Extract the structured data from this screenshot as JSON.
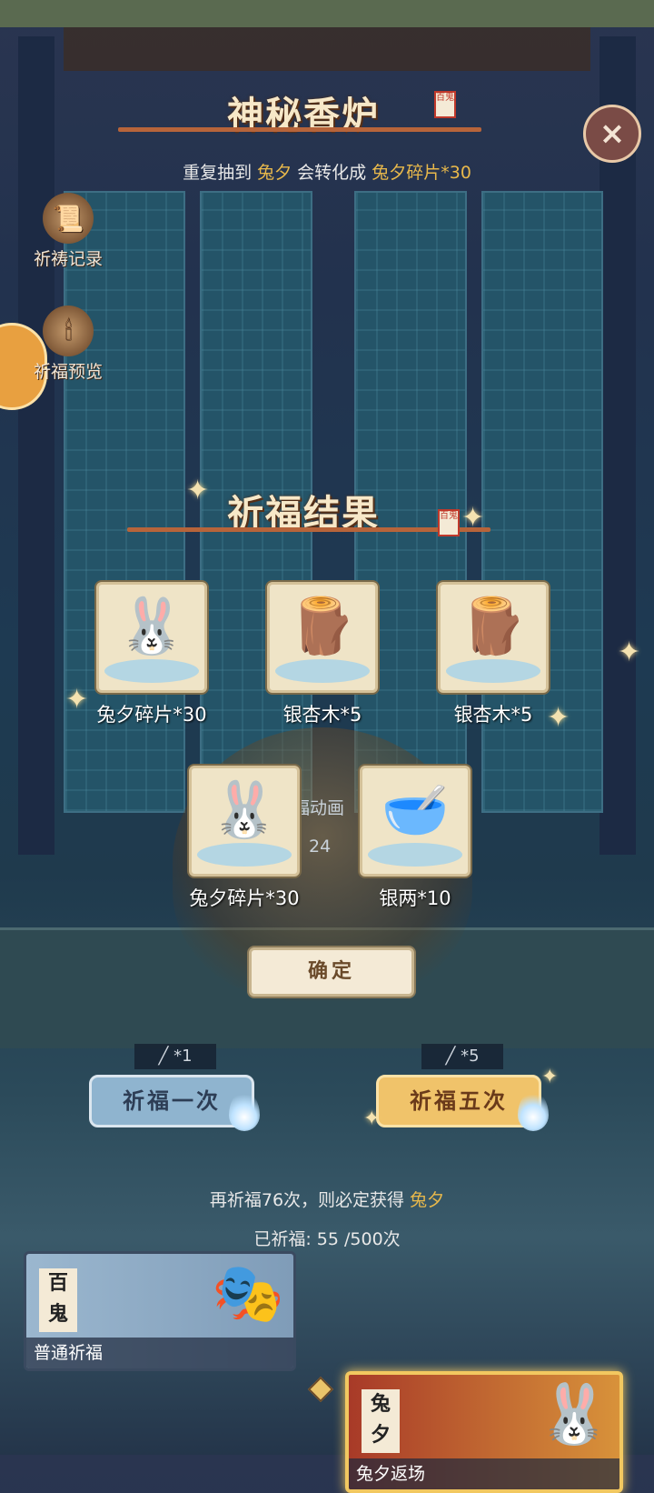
{
  "header": {
    "title": "神秘香炉",
    "seal": "百鬼",
    "subtitle_prefix": "重复抽到 ",
    "subtitle_item": "兔夕",
    "subtitle_mid": " 会转化成 ",
    "subtitle_result": "兔夕碎片*30",
    "close_icon": "×"
  },
  "side": {
    "record_label": "祈祷记录",
    "preview_label": "祈福预览"
  },
  "result": {
    "title": "祈福结果",
    "seal": "百鬼",
    "items": [
      {
        "label": "兔夕碎片*30",
        "icon": "🐰"
      },
      {
        "label": "银杏木*5",
        "icon": "🪵"
      },
      {
        "label": "银杏木*5",
        "icon": "🪵"
      },
      {
        "label": "兔夕碎片*30",
        "icon": "🐰"
      },
      {
        "label": "银两*10",
        "icon": "🥣"
      }
    ],
    "hidden_label": "福动画",
    "hidden_number": "24",
    "confirm_label": "确定"
  },
  "pray": {
    "once_count": "*1",
    "five_count": "*5",
    "once_label": "祈福一次",
    "five_label": "祈福五次"
  },
  "info": {
    "guarantee_prefix": "再祈福76次，则必定获得 ",
    "guarantee_item": "兔夕",
    "progress_prefix": "已祈福: ",
    "progress_value": "55 /500次"
  },
  "banners": {
    "normal_tag": "百鬼",
    "normal_label": "普通祈福",
    "event_tag": "兔夕",
    "event_label": "兔夕返场"
  },
  "colors": {
    "accent_gold": "#e9b94b",
    "title_cream": "#f7e8c8"
  }
}
